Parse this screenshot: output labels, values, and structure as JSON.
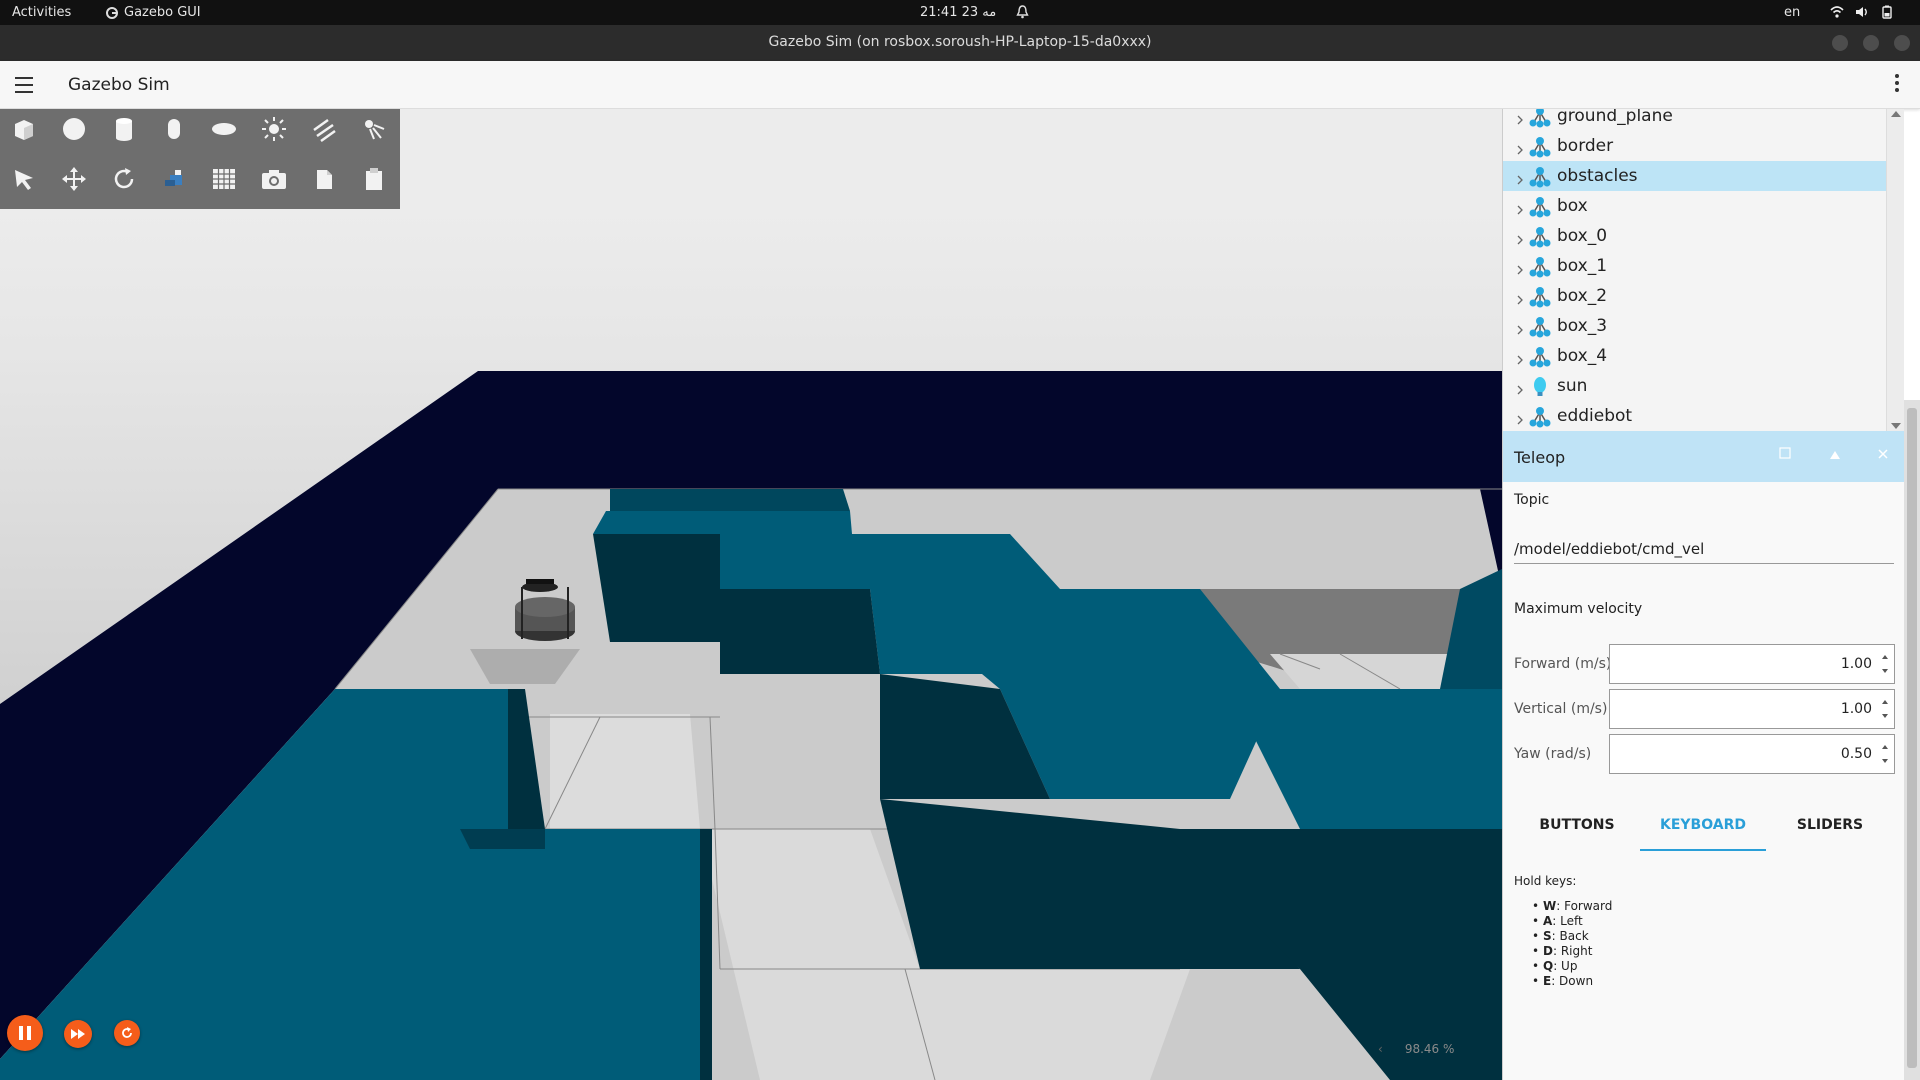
{
  "system_bar": {
    "activities": "Activities",
    "app_name": "Gazebo GUI",
    "clock": "21:41  مه 23",
    "language": "en"
  },
  "window": {
    "title": "Gazebo Sim (on rosbox.soroush-HP-Laptop-15-da0xxx)"
  },
  "app_bar": {
    "title": "Gazebo Sim"
  },
  "toolbar": {
    "row1": [
      "box-icon",
      "sphere-icon",
      "cylinder-icon",
      "capsule-icon",
      "ellipsoid-icon",
      "point-light-icon",
      "directional-light-icon",
      "spot-light-icon"
    ],
    "row2": [
      "select-icon",
      "translate-icon",
      "rotate-icon",
      "transform-control-icon",
      "grid-icon",
      "screenshot-icon",
      "copy-icon",
      "paste-icon"
    ]
  },
  "entity_tree": {
    "items": [
      {
        "label": "ground_plane",
        "icon": "model-icon"
      },
      {
        "label": "border",
        "icon": "model-icon"
      },
      {
        "label": "obstacles",
        "icon": "model-icon",
        "selected": true
      },
      {
        "label": "box",
        "icon": "model-icon"
      },
      {
        "label": "box_0",
        "icon": "model-icon"
      },
      {
        "label": "box_1",
        "icon": "model-icon"
      },
      {
        "label": "box_2",
        "icon": "model-icon"
      },
      {
        "label": "box_3",
        "icon": "model-icon"
      },
      {
        "label": "box_4",
        "icon": "model-icon"
      },
      {
        "label": "sun",
        "icon": "light-icon"
      },
      {
        "label": "eddiebot",
        "icon": "model-icon"
      }
    ]
  },
  "teleop": {
    "title": "Teleop",
    "topic_label": "Topic",
    "topic_value": "/model/eddiebot/cmd_vel",
    "max_velocity_label": "Maximum velocity",
    "forward_label": "Forward (m/s)",
    "forward_value": "1.00",
    "vertical_label": "Vertical (m/s)",
    "vertical_value": "1.00",
    "yaw_label": "Yaw (rad/s)",
    "yaw_value": "0.50",
    "tabs": [
      "BUTTONS",
      "KEYBOARD",
      "SLIDERS"
    ],
    "active_tab": "KEYBOARD",
    "hold_keys_label": "Hold keys:",
    "keys": [
      {
        "key": "W",
        "action": ": Forward"
      },
      {
        "key": "A",
        "action": ": Left"
      },
      {
        "key": "S",
        "action": ": Back"
      },
      {
        "key": "D",
        "action": ": Right"
      },
      {
        "key": "Q",
        "action": ": Up"
      },
      {
        "key": "E",
        "action": ": Down"
      }
    ]
  },
  "playback": {
    "real_time_factor": "98.46 %"
  },
  "colors": {
    "accent": "#2a9fd8",
    "play_button": "#f55d1a",
    "obstacle": "#005c78",
    "wall": "#03062b",
    "selected_row": "#bde4f6"
  }
}
